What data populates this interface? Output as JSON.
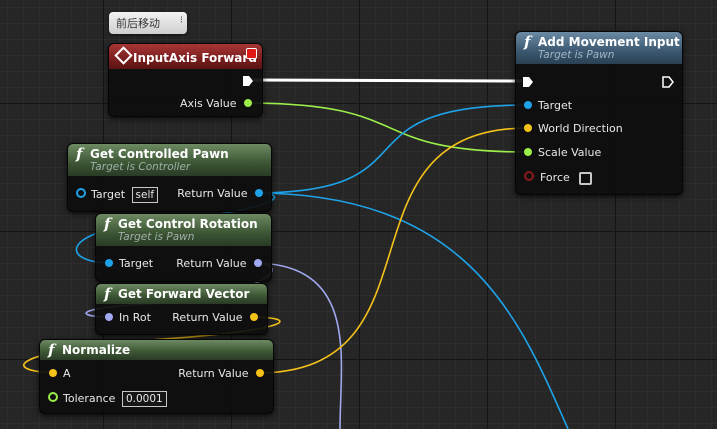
{
  "comment": {
    "text": "前后移动",
    "close_icon": "collapse-icon"
  },
  "input_axis": {
    "title": "InputAxis Forward",
    "axis_value_label": "Axis Value"
  },
  "add_movement": {
    "title": "Add Movement Input",
    "subtitle": "Target is Pawn",
    "target_label": "Target",
    "world_direction_label": "World Direction",
    "scale_value_label": "Scale Value",
    "force_label": "Force",
    "force_checked": false
  },
  "get_pawn": {
    "title": "Get Controlled Pawn",
    "subtitle": "Target is Controller",
    "target_label": "Target",
    "target_value": "self",
    "return_label": "Return Value"
  },
  "get_rotation": {
    "title": "Get Control Rotation",
    "subtitle": "Target is Pawn",
    "target_label": "Target",
    "return_label": "Return Value"
  },
  "get_forward": {
    "title": "Get Forward Vector",
    "in_label": "In Rot",
    "return_label": "Return Value"
  },
  "normalize": {
    "title": "Normalize",
    "a_label": "A",
    "tolerance_label": "Tolerance",
    "tolerance_value": "0.0001",
    "return_label": "Return Value"
  },
  "colors": {
    "exec": "#ffffff",
    "object": "#1ea3e8",
    "vector": "#f5c21a",
    "float": "#9cee4a",
    "rotator": "#a0a8f0",
    "bool_off": "#8b1a1a"
  }
}
